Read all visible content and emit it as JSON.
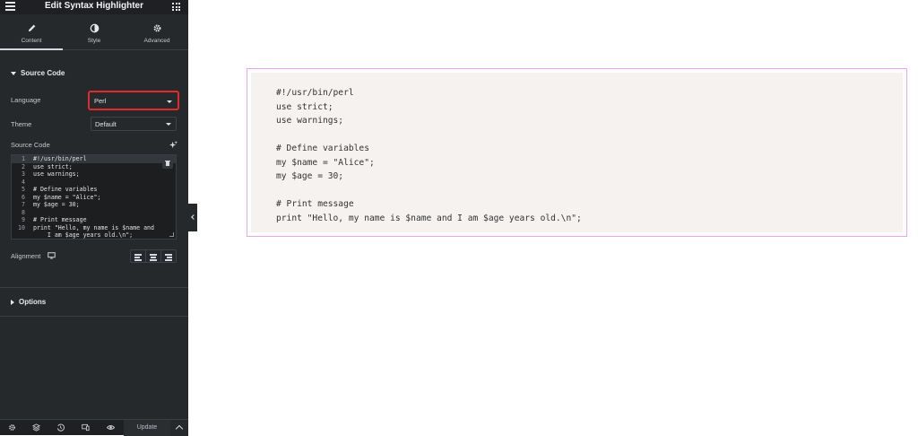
{
  "panel": {
    "title": "Edit Syntax Highlighter",
    "tabs": [
      {
        "label": "Content",
        "icon": "pencil-icon",
        "active": true
      },
      {
        "label": "Style",
        "icon": "half-circle-icon",
        "active": false
      },
      {
        "label": "Advanced",
        "icon": "gear-icon",
        "active": false
      }
    ],
    "source_section": {
      "title": "Source Code",
      "language_label": "Language",
      "language_value": "Perl",
      "theme_label": "Theme",
      "theme_value": "Default",
      "source_code_label": "Source Code",
      "alignment_label": "Alignment"
    },
    "editor_lines": [
      {
        "num": "1",
        "text": "#!/usr/bin/perl"
      },
      {
        "num": "2",
        "text": "use strict;"
      },
      {
        "num": "3",
        "text": "use warnings;"
      },
      {
        "num": "4",
        "text": ""
      },
      {
        "num": "5",
        "text": "# Define variables"
      },
      {
        "num": "6",
        "text": "my $name = \"Alice\";"
      },
      {
        "num": "7",
        "text": "my $age = 30;"
      },
      {
        "num": "8",
        "text": ""
      },
      {
        "num": "9",
        "text": "# Print message"
      },
      {
        "num": "10",
        "text": "print \"Hello, my name is $name and"
      },
      {
        "num": "",
        "text": "    I am $age years old.\\n\";"
      }
    ],
    "options_section": {
      "title": "Options"
    },
    "footer": {
      "update_label": "Update",
      "icons": [
        "gear-icon",
        "layers-icon",
        "history-icon",
        "responsive-icon",
        "eye-icon"
      ]
    }
  },
  "preview": {
    "code_lines": [
      "#!/usr/bin/perl",
      "use strict;",
      "use warnings;",
      "",
      "# Define variables",
      "my $name = \"Alice\";",
      "my $age = 30;",
      "",
      "# Print message",
      "print \"Hello, my name is $name and I am $age years old.\\n\";"
    ]
  },
  "colors": {
    "panel_bg": "#26292c",
    "highlight_border": "#e02b2b",
    "preview_border": "#e6a7ee",
    "code_bg": "#f5f2f0"
  }
}
